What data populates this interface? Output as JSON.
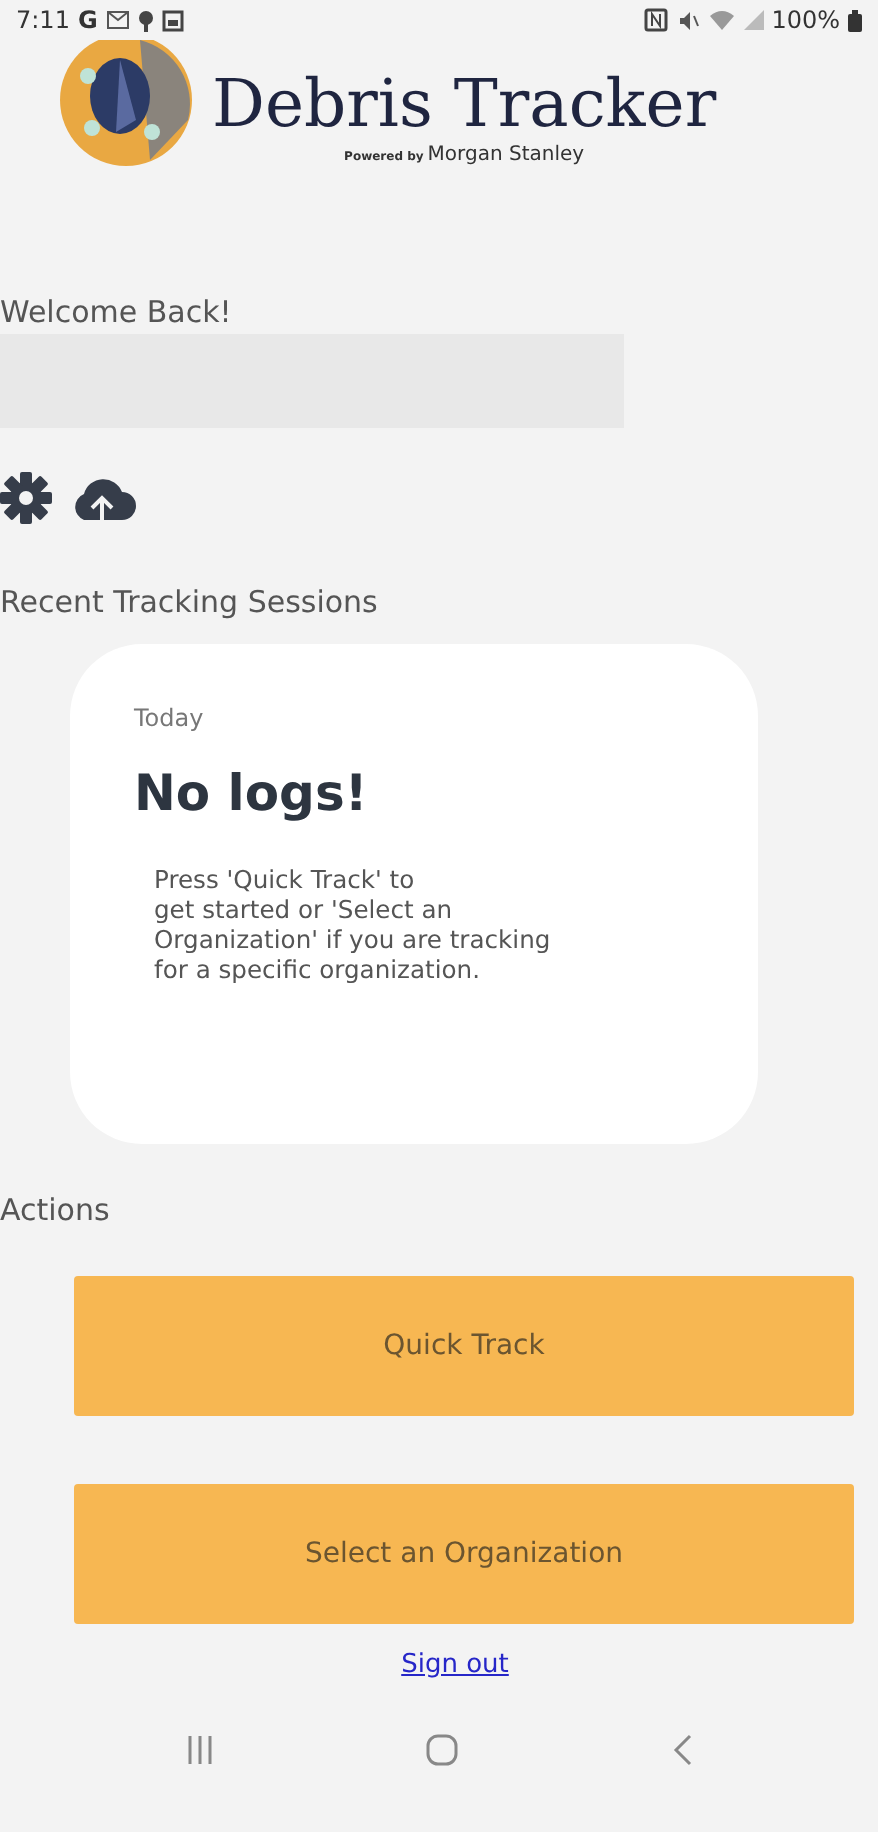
{
  "status_bar": {
    "time": "7:11",
    "carrier": "G",
    "battery": "100%"
  },
  "header": {
    "title": "Debris Tracker",
    "powered_by": "Powered by",
    "sponsor": "Morgan Stanley"
  },
  "welcome": "Welcome Back!",
  "toolbar": [
    {
      "kind": "settings"
    },
    {
      "kind": "upload"
    }
  ],
  "recent": {
    "heading": "Recent Tracking Sessions",
    "card": {
      "date": "Today",
      "title": "No logs!",
      "message": "Press 'Quick Track' to\nget started or 'Select an\nOrganization' if you are tracking\nfor a specific organization."
    }
  },
  "actions": {
    "heading": "Actions",
    "buttons": [
      "Quick Track",
      "Select an Organization"
    ]
  },
  "sign_out": "Sign out",
  "nav_bar": [
    {
      "kind": "recents"
    },
    {
      "kind": "home"
    },
    {
      "kind": "back"
    }
  ]
}
